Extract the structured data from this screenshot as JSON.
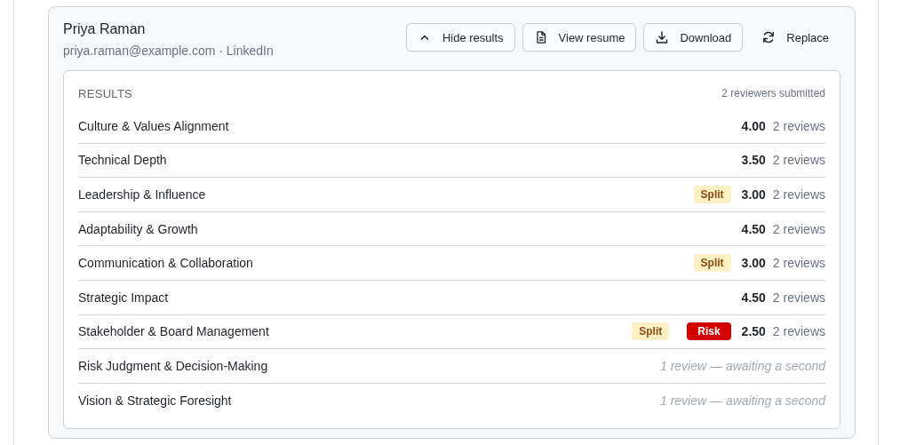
{
  "candidate": {
    "name": "Priya Raman",
    "contact": "priya.raman@example.com · LinkedIn"
  },
  "actions": [
    {
      "kind": "collapse",
      "label": "Hide results",
      "outlined": true
    },
    {
      "kind": "document",
      "label": "View resume",
      "outlined": true
    },
    {
      "kind": "download",
      "label": "Download",
      "outlined": true
    },
    {
      "kind": "refresh",
      "label": "Replace",
      "outlined": false
    }
  ],
  "results": {
    "title": "RESULTS",
    "summary": "2 reviewers submitted",
    "rows": [
      {
        "name": "Culture & Values Alignment",
        "badges": [],
        "score": "4.00",
        "reviews": "2 reviews"
      },
      {
        "name": "Technical Depth",
        "badges": [],
        "score": "3.50",
        "reviews": "2 reviews"
      },
      {
        "name": "Leadership & Influence",
        "badges": [
          {
            "kind": "split",
            "label": "Split"
          }
        ],
        "score": "3.00",
        "reviews": "2 reviews"
      },
      {
        "name": "Adaptability & Growth",
        "badges": [],
        "score": "4.50",
        "reviews": "2 reviews"
      },
      {
        "name": "Communication & Collaboration",
        "badges": [
          {
            "kind": "split",
            "label": "Split"
          }
        ],
        "score": "3.00",
        "reviews": "2 reviews"
      },
      {
        "name": "Strategic Impact",
        "badges": [],
        "score": "4.50",
        "reviews": "2 reviews"
      },
      {
        "name": "Stakeholder & Board Management",
        "badges": [
          {
            "kind": "split",
            "label": "Split"
          },
          {
            "kind": "risk",
            "label": "Risk"
          }
        ],
        "score": "2.50",
        "reviews": "2 reviews"
      },
      {
        "name": "Risk Judgment & Decision-Making",
        "pending": "1 review — awaiting a second"
      },
      {
        "name": "Vision & Strategic Foresight",
        "pending": "1 review — awaiting a second"
      }
    ]
  }
}
